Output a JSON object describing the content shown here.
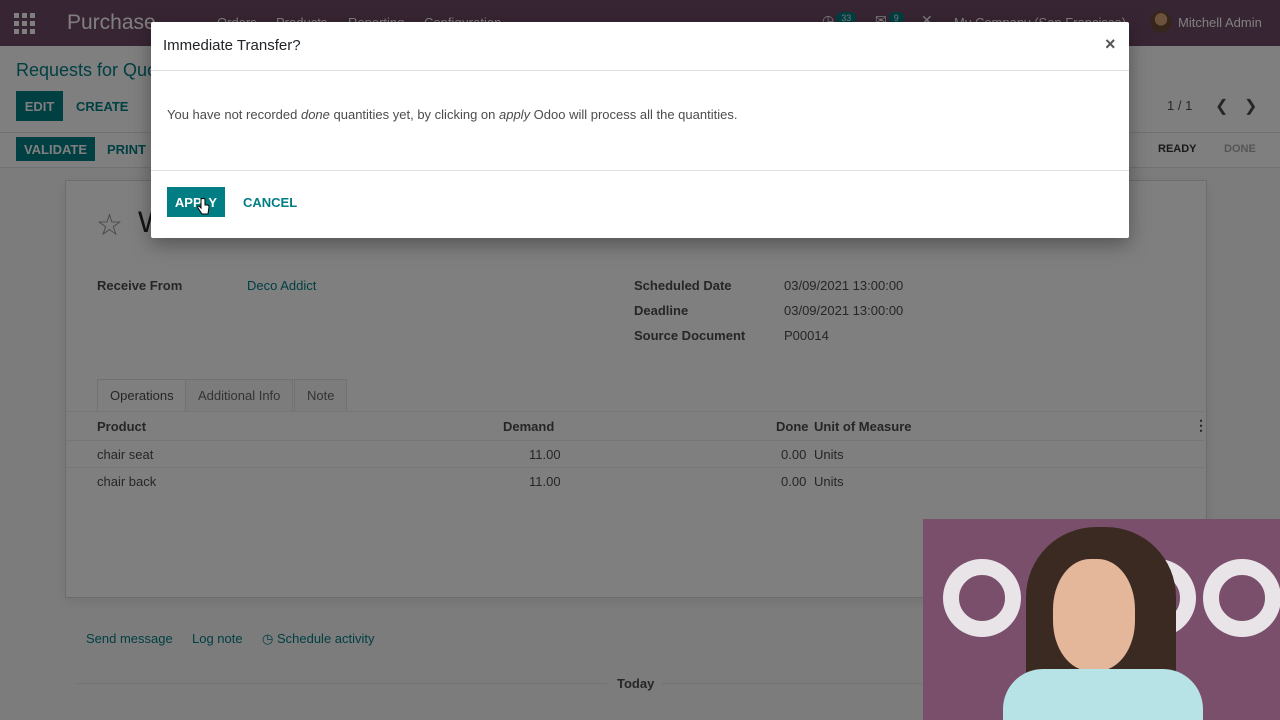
{
  "navbar": {
    "app_name": "Purchase",
    "menu": [
      "Orders",
      "Products",
      "Reporting",
      "Configuration"
    ],
    "activity_count": "33",
    "message_count": "9",
    "company": "My Company (San Francisco)",
    "user": "Mitchell Admin"
  },
  "control_panel": {
    "breadcrumb": "Requests for Quo",
    "edit_label": "EDIT",
    "create_label": "CREATE",
    "pager": "1 / 1"
  },
  "statusbar": {
    "validate_label": "VALIDATE",
    "print_label": "PRINT",
    "stages": [
      "READY",
      "DONE"
    ]
  },
  "form": {
    "title_fragment": "W",
    "receive_from_label": "Receive From",
    "receive_from_value": "Deco Addict",
    "scheduled_date_label": "Scheduled Date",
    "scheduled_date_value": "03/09/2021 13:00:00",
    "deadline_label": "Deadline",
    "deadline_value": "03/09/2021 13:00:00",
    "source_document_label": "Source Document",
    "source_document_value": "P00014",
    "tabs": [
      "Operations",
      "Additional Info",
      "Note"
    ],
    "columns": [
      "Product",
      "Demand",
      "Done",
      "Unit of Measure"
    ],
    "rows": [
      {
        "product": "chair seat",
        "demand": "11.00",
        "done": "0.00",
        "uom": "Units"
      },
      {
        "product": "chair back",
        "demand": "11.00",
        "done": "0.00",
        "uom": "Units"
      }
    ]
  },
  "chatter": {
    "send_message": "Send message",
    "log_note": "Log note",
    "schedule_activity": "Schedule activity",
    "today": "Today"
  },
  "modal": {
    "title": "Immediate Transfer?",
    "close_glyph": "×",
    "body_pre": "You have not recorded ",
    "body_em1": "done",
    "body_mid": " quantities yet, by clicking on ",
    "body_em2": "apply",
    "body_post": " Odoo will process all the quantities.",
    "apply_label": "APPLY",
    "cancel_label": "CANCEL"
  },
  "colors": {
    "brand": "#714b67",
    "accent": "#017e84"
  },
  "icons": {
    "apps": "apps-grid-icon",
    "star": "star-icon",
    "close": "close-icon",
    "clock": "clock-icon",
    "cursor": "hand-pointer-icon"
  }
}
